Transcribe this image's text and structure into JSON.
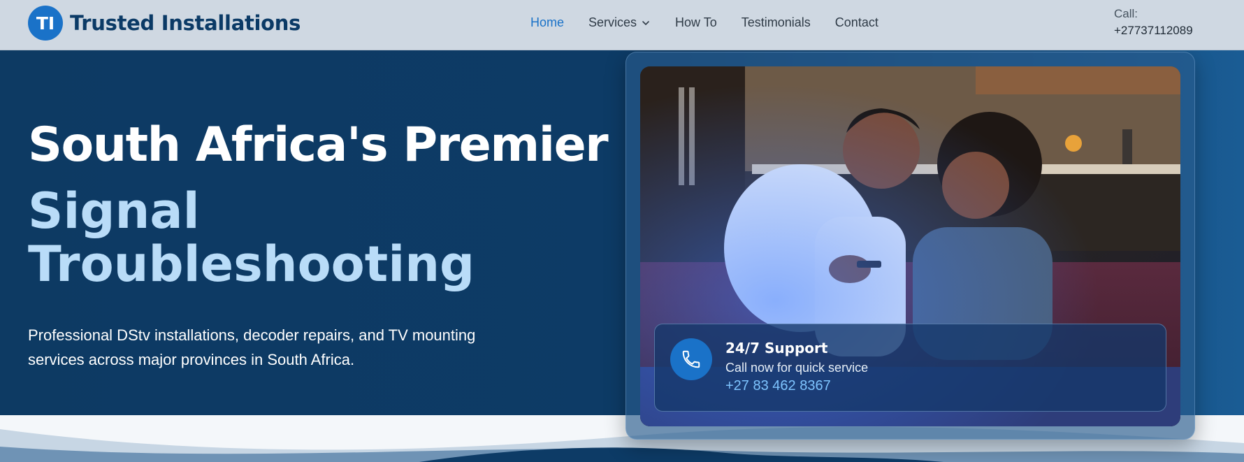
{
  "brand": {
    "logo_initials": "TI",
    "name": "Trusted Installations"
  },
  "nav": {
    "items": [
      {
        "label": "Home",
        "active": true
      },
      {
        "label": "Services",
        "has_dropdown": true
      },
      {
        "label": "How To"
      },
      {
        "label": "Testimonials"
      },
      {
        "label": "Contact"
      }
    ]
  },
  "call": {
    "label": "Call:",
    "number": "+27737112089"
  },
  "hero": {
    "headline": "South Africa's Premier",
    "subheadline": "Signal Troubleshooting",
    "description": "Professional DStv installations, decoder repairs, and TV mounting services across major provinces in South Africa."
  },
  "support": {
    "title": "24/7 Support",
    "subtitle": "Call now for quick service",
    "phone": "+27 83 462 8367",
    "icon": "phone-icon"
  },
  "colors": {
    "accent": "#1a72c8",
    "header_bg": "#cfd8e2",
    "hero_bg": "#0d3a63",
    "headline_light": "#b9dcf8",
    "phone_link": "#7ec4ff"
  }
}
